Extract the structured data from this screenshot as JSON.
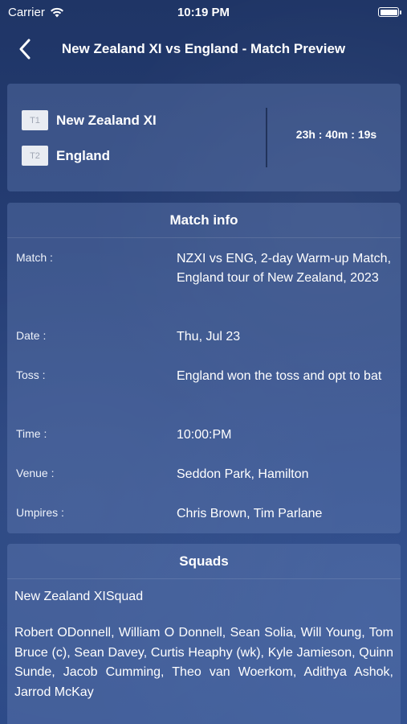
{
  "status_bar": {
    "carrier": "Carrier",
    "time": "10:19 PM"
  },
  "nav": {
    "title": "New Zealand XI vs England - Match Preview",
    "back_icon": "chevron-left-icon"
  },
  "teams": {
    "team1": {
      "badge": "T1",
      "name": "New Zealand XI"
    },
    "team2": {
      "badge": "T2",
      "name": "England"
    },
    "countdown": "23h : 40m : 19s"
  },
  "match_info": {
    "heading": "Match info",
    "rows": [
      {
        "label": "Match   :",
        "value": "NZXI vs ENG, 2-day Warm-up Match, England tour of New Zealand, 2023"
      },
      {
        "label": "Date   :",
        "value": "Thu, Jul 23"
      },
      {
        "label": "Toss   :",
        "value": "England won the toss and opt to bat"
      },
      {
        "label": "Time   :",
        "value": "10:00:PM"
      },
      {
        "label": "Venue   :",
        "value": "Seddon Park, Hamilton"
      },
      {
        "label": "Umpires   :",
        "value": "Chris Brown, Tim Parlane"
      }
    ]
  },
  "squads": {
    "heading": "Squads",
    "team1_title": "New Zealand XISquad",
    "team1_players": "Robert ODonnell, William O Donnell, Sean Solia, Will Young, Tom Bruce (c), Sean Davey, Curtis Heaphy (wk), Kyle Jamieson, Quinn Sunde, Jacob Cumming, Theo van Woerkom, Adithya Ashok, Jarrod McKay"
  }
}
